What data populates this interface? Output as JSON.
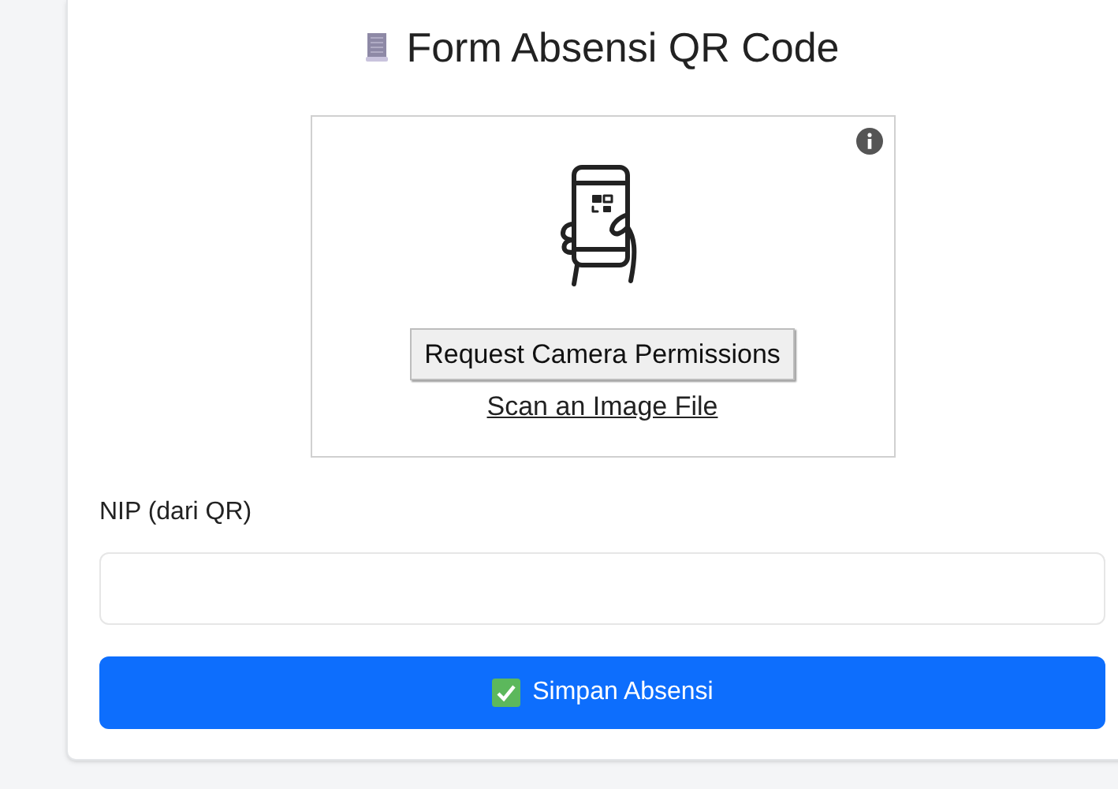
{
  "title": "Form Absensi QR Code",
  "scanner": {
    "permission_button": "Request Camera Permissions",
    "scan_file_link": "Scan an Image File"
  },
  "nip_field": {
    "label": "NIP (dari QR)"
  },
  "submit_button": {
    "label": "Simpan Absensi"
  }
}
